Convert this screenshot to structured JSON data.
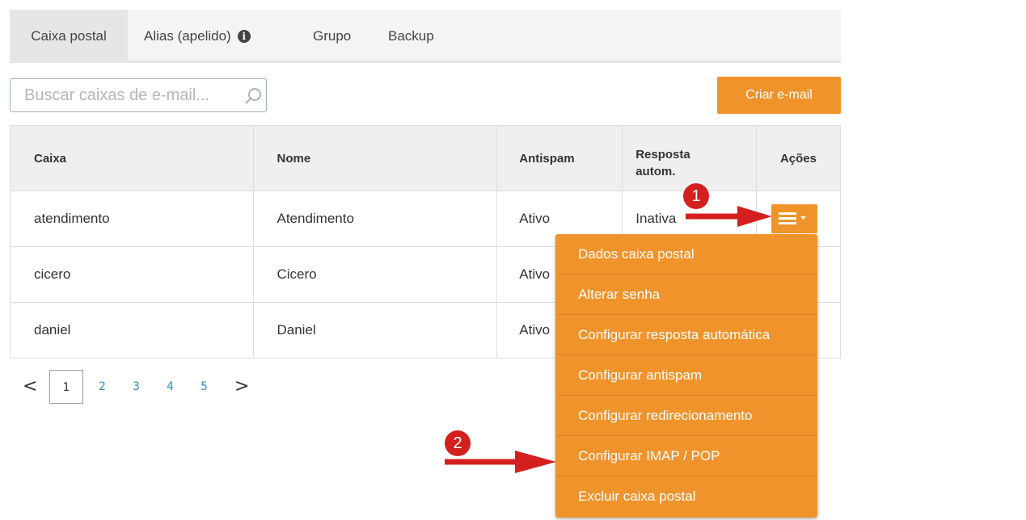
{
  "tabs": [
    {
      "label": "Caixa postal"
    },
    {
      "label": "Alias (apelido)"
    },
    {
      "label": "Grupo"
    },
    {
      "label": "Backup"
    }
  ],
  "info_icon": {
    "glyph": "i"
  },
  "search": {
    "placeholder": "Buscar caixas de e-mail..."
  },
  "create_button": {
    "label": "Criar e-mail"
  },
  "table": {
    "headers": [
      "Caixa",
      "Nome",
      "Antispam",
      "Resposta",
      "autom.",
      "Ações"
    ],
    "rows": [
      [
        "atendimento",
        "Atendimento",
        "Ativo",
        "Inativa"
      ],
      [
        "cicero",
        "Cicero",
        "Ativo",
        ""
      ],
      [
        "daniel",
        "Daniel",
        "Ativo",
        ""
      ]
    ]
  },
  "pagination": {
    "prev": "<",
    "pages": [
      "1",
      "2",
      "3",
      "4",
      "5"
    ],
    "next": ">",
    "current": "1"
  },
  "menu": {
    "items": [
      "Dados caixa postal",
      "Alterar senha",
      "Configurar resposta automática",
      "Configurar antispam",
      "Configurar redirecionamento",
      "Configurar IMAP / POP",
      "Excluir caixa postal"
    ]
  },
  "annotations": {
    "badge1": "1",
    "badge2": "2"
  },
  "colors": {
    "accent": "#f0932b",
    "annotation": "#d41f1f",
    "link": "#2e8ec7"
  }
}
